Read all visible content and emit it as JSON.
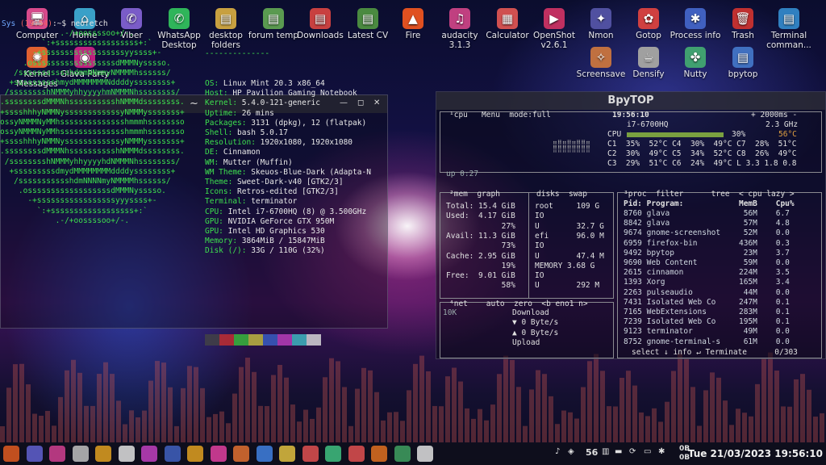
{
  "desktop": {
    "row1": [
      {
        "label": "Computer",
        "icon": "computer-icon",
        "color": "#d84a8c",
        "glyph": "🖥"
      },
      {
        "label": "Home",
        "icon": "home-icon",
        "color": "#3aa0c8",
        "glyph": "⌂"
      },
      {
        "label": "Viber",
        "icon": "viber-icon",
        "color": "#7a5cc8",
        "glyph": "✆"
      },
      {
        "label": "WhatsApp Desktop",
        "icon": "whatsapp-icon",
        "color": "#2fb55a",
        "glyph": "✆"
      },
      {
        "label": "desktop folders",
        "icon": "folder-icon",
        "color": "#c8a040",
        "glyph": "▤"
      },
      {
        "label": "forum temp",
        "icon": "folder-icon",
        "color": "#5a9a50",
        "glyph": "▤"
      },
      {
        "label": "Downloads",
        "icon": "downloads-folder-icon",
        "color": "#c84040",
        "glyph": "▤"
      },
      {
        "label": "Latest CV",
        "icon": "folder-icon",
        "color": "#4a8a40",
        "glyph": "▤"
      },
      {
        "label": "Fire",
        "icon": "fire-icon",
        "color": "#e05020",
        "glyph": "▲"
      },
      {
        "label": "audacity 3.1.3",
        "icon": "audacity-icon",
        "color": "#c04080",
        "glyph": "♫"
      },
      {
        "label": "Calculator",
        "icon": "calculator-icon",
        "color": "#d05050",
        "glyph": "▦"
      },
      {
        "label": "OpenShot v2.6.1",
        "icon": "openshot-icon",
        "color": "#c03060",
        "glyph": "▶"
      },
      {
        "label": "Nmon",
        "icon": "nmon-icon",
        "color": "#5050a0",
        "glyph": "✦"
      },
      {
        "label": "Gotop",
        "icon": "gotop-icon",
        "color": "#d04040",
        "glyph": "✿"
      },
      {
        "label": "Process info",
        "icon": "process-icon",
        "color": "#4060c0",
        "glyph": "✱"
      },
      {
        "label": "Trash",
        "icon": "trash-icon",
        "color": "#c03030",
        "glyph": "🗑"
      },
      {
        "label": "Terminal comman...",
        "icon": "terminal-icon",
        "color": "#3080c0",
        "glyph": "▤"
      }
    ],
    "row2": [
      {
        "label": "Kernel Messages",
        "icon": "kernel-icon",
        "color": "#e06030",
        "glyph": "✺",
        "col": 0
      },
      {
        "label": "Glava Party",
        "icon": "glava-icon",
        "color": "#c02080",
        "glyph": "◉",
        "col": 1
      },
      {
        "label": "Screensave",
        "icon": "screensaver-icon",
        "color": "#c07040",
        "glyph": "✧",
        "col": 12
      },
      {
        "label": "Densify",
        "icon": "densify-icon",
        "color": "#a0a0a0",
        "glyph": "☕",
        "col": 13
      },
      {
        "label": "Nutty",
        "icon": "nutty-icon",
        "color": "#40a070",
        "glyph": "✤",
        "col": 14
      },
      {
        "label": "bpytop",
        "icon": "bpytop-icon",
        "color": "#4070c0",
        "glyph": "▤",
        "col": 15
      }
    ]
  },
  "terminal": {
    "title": "~",
    "prompt_user": "Sys",
    "prompt_time": "(19:54)",
    "prompt_cmd": ":~$ neofetch",
    "separator": "--------------",
    "info": [
      {
        "k": "OS:",
        "v": " Linux Mint 20.3 x86_64"
      },
      {
        "k": "Host:",
        "v": " HP Pavilion Gaming Notebook"
      },
      {
        "k": "Kernel:",
        "v": " 5.4.0-121-generic"
      },
      {
        "k": "Uptime:",
        "v": " 26 mins"
      },
      {
        "k": "Packages:",
        "v": " 3131 (dpkg), 12 (flatpak)"
      },
      {
        "k": "Shell:",
        "v": " bash 5.0.17"
      },
      {
        "k": "Resolution:",
        "v": " 1920x1080, 1920x1080"
      },
      {
        "k": "DE:",
        "v": " Cinnamon"
      },
      {
        "k": "WM:",
        "v": " Mutter (Muffin)"
      },
      {
        "k": "WM Theme:",
        "v": " Skeuos-Blue-Dark (Adapta-N"
      },
      {
        "k": "Theme:",
        "v": " Sweet-Dark-v40 [GTK2/3]"
      },
      {
        "k": "Icons:",
        "v": " Retros-edited [GTK2/3]"
      },
      {
        "k": "Terminal:",
        "v": " terminator"
      },
      {
        "k": "CPU:",
        "v": " Intel i7-6700HQ (8) @ 3.500GHz"
      },
      {
        "k": "GPU:",
        "v": " NVIDIA GeForce GTX 950M"
      },
      {
        "k": "GPU:",
        "v": " Intel HD Graphics 530"
      },
      {
        "k": "Memory:",
        "v": " 3864MiB / 15847MiB"
      },
      {
        "k": "Disk (/):",
        "v": " 33G / 110G (32%)"
      }
    ],
    "swatches": [
      "#444444",
      "#c83030",
      "#3ac03a",
      "#c8c040",
      "#3a60c8",
      "#c040c0",
      "#40c0c8",
      "#e0e0e0"
    ]
  },
  "bpytop": {
    "title": "BpyTOP",
    "cpu_tabs": "¹cpu   Menu  mode:full",
    "clock": "19:56:10",
    "interval": "+ 2000ms -",
    "cpu_model": "i7-6700HQ",
    "freq": "2.3 GHz",
    "cpu_total": "CPU",
    "cpu_total_pct": "30%",
    "cpu_temp": "56°C",
    "cores": [
      "C1  35%  52°C C4  30%  49°C C7  28%  51°C",
      "C2  30%  49°C C5  34%  52°C C8  26%  49°C",
      "C3  29%  51°C C6  24%  49°C L 3.3 1.8 0.8"
    ],
    "uptime": "up 0:27",
    "mem_header": "²mem  graph",
    "mem_lines": [
      "Total: 15.4 GiB",
      "Used:  4.17 GiB",
      "            27%",
      "Avail: 11.3 GiB",
      "            73%",
      "Cache: 2.95 GiB",
      "            19%",
      "Free:  9.01 GiB",
      "            58%"
    ],
    "disk_header": "disks  swap",
    "disk_lines": [
      "root     109 G",
      "IO",
      "U        32.7 G",
      "efi      96.0 M",
      "IO",
      "U        47.4 M",
      "MEMORY 3.68 G",
      "IO",
      "U        292 M"
    ],
    "proc_header": "³proc  filter      tree  < cpu lazy >",
    "proc_cols": "Pid: Program:            MemB    Cpu%",
    "procs": [
      "8760 glava                56M    6.7",
      "8842 glava                57M    4.8",
      "9674 gnome-screenshot     52M    0.0",
      "6959 firefox-bin         436M    0.3",
      "9492 bpytop               23M    3.7",
      "9690 Web Content          59M    0.0",
      "2615 cinnamon            224M    3.5",
      "1393 Xorg                165M    3.4",
      "2263 pulseaudio           44M    0.0",
      "7431 Isolated Web Co     247M    0.1",
      "7165 WebExtensions       283M    0.1",
      "7239 Isolated Web Co     195M    0.1",
      "9123 terminator           49M    0.0",
      "8752 gnome-terminal-s     61M    0.0"
    ],
    "proc_footer": "select ↓ info ↵ Terminate      0/303",
    "net_header": "⁴net    auto  zero  <b eno1 n>",
    "net_scale": "10K",
    "net_lines": [
      "Download",
      "▼ 0 Byte/s",
      "▲ 0 Byte/s",
      "Upload"
    ]
  },
  "taskbar": {
    "apps": [
      {
        "icon": "menu-icon",
        "color": "#e05a20"
      },
      {
        "icon": "files-icon",
        "color": "#6060d0"
      },
      {
        "icon": "folder-icon",
        "color": "#d04090"
      },
      {
        "icon": "archive-icon",
        "color": "#c0c0c0"
      },
      {
        "icon": "search-icon",
        "color": "#e0a020"
      },
      {
        "icon": "keyboard-icon",
        "color": "#e0e0e0"
      },
      {
        "icon": "cpu-icon",
        "color": "#c040c0"
      },
      {
        "icon": "screenshot-icon",
        "color": "#4060c0"
      },
      {
        "icon": "bolt-icon",
        "color": "#e0a020"
      },
      {
        "icon": "music-icon",
        "color": "#e040a0"
      },
      {
        "icon": "video-icon",
        "color": "#e07030"
      },
      {
        "icon": "inkscape-icon",
        "color": "#4080e0"
      },
      {
        "icon": "palette-icon",
        "color": "#e0c040"
      },
      {
        "icon": "terminal-icon",
        "color": "#e05050"
      },
      {
        "icon": "radio-icon",
        "color": "#40c080"
      },
      {
        "icon": "terminal-icon",
        "color": "#e05050"
      },
      {
        "icon": "firefox-icon",
        "color": "#e07020"
      },
      {
        "icon": "mail-icon",
        "color": "#40a060"
      },
      {
        "icon": "clock-icon",
        "color": "#e0e0e0"
      }
    ],
    "tray_temp": "56",
    "net_up": "0B",
    "net_down": "0B",
    "clock": "Tue 21/03/2023 19:56:10"
  }
}
